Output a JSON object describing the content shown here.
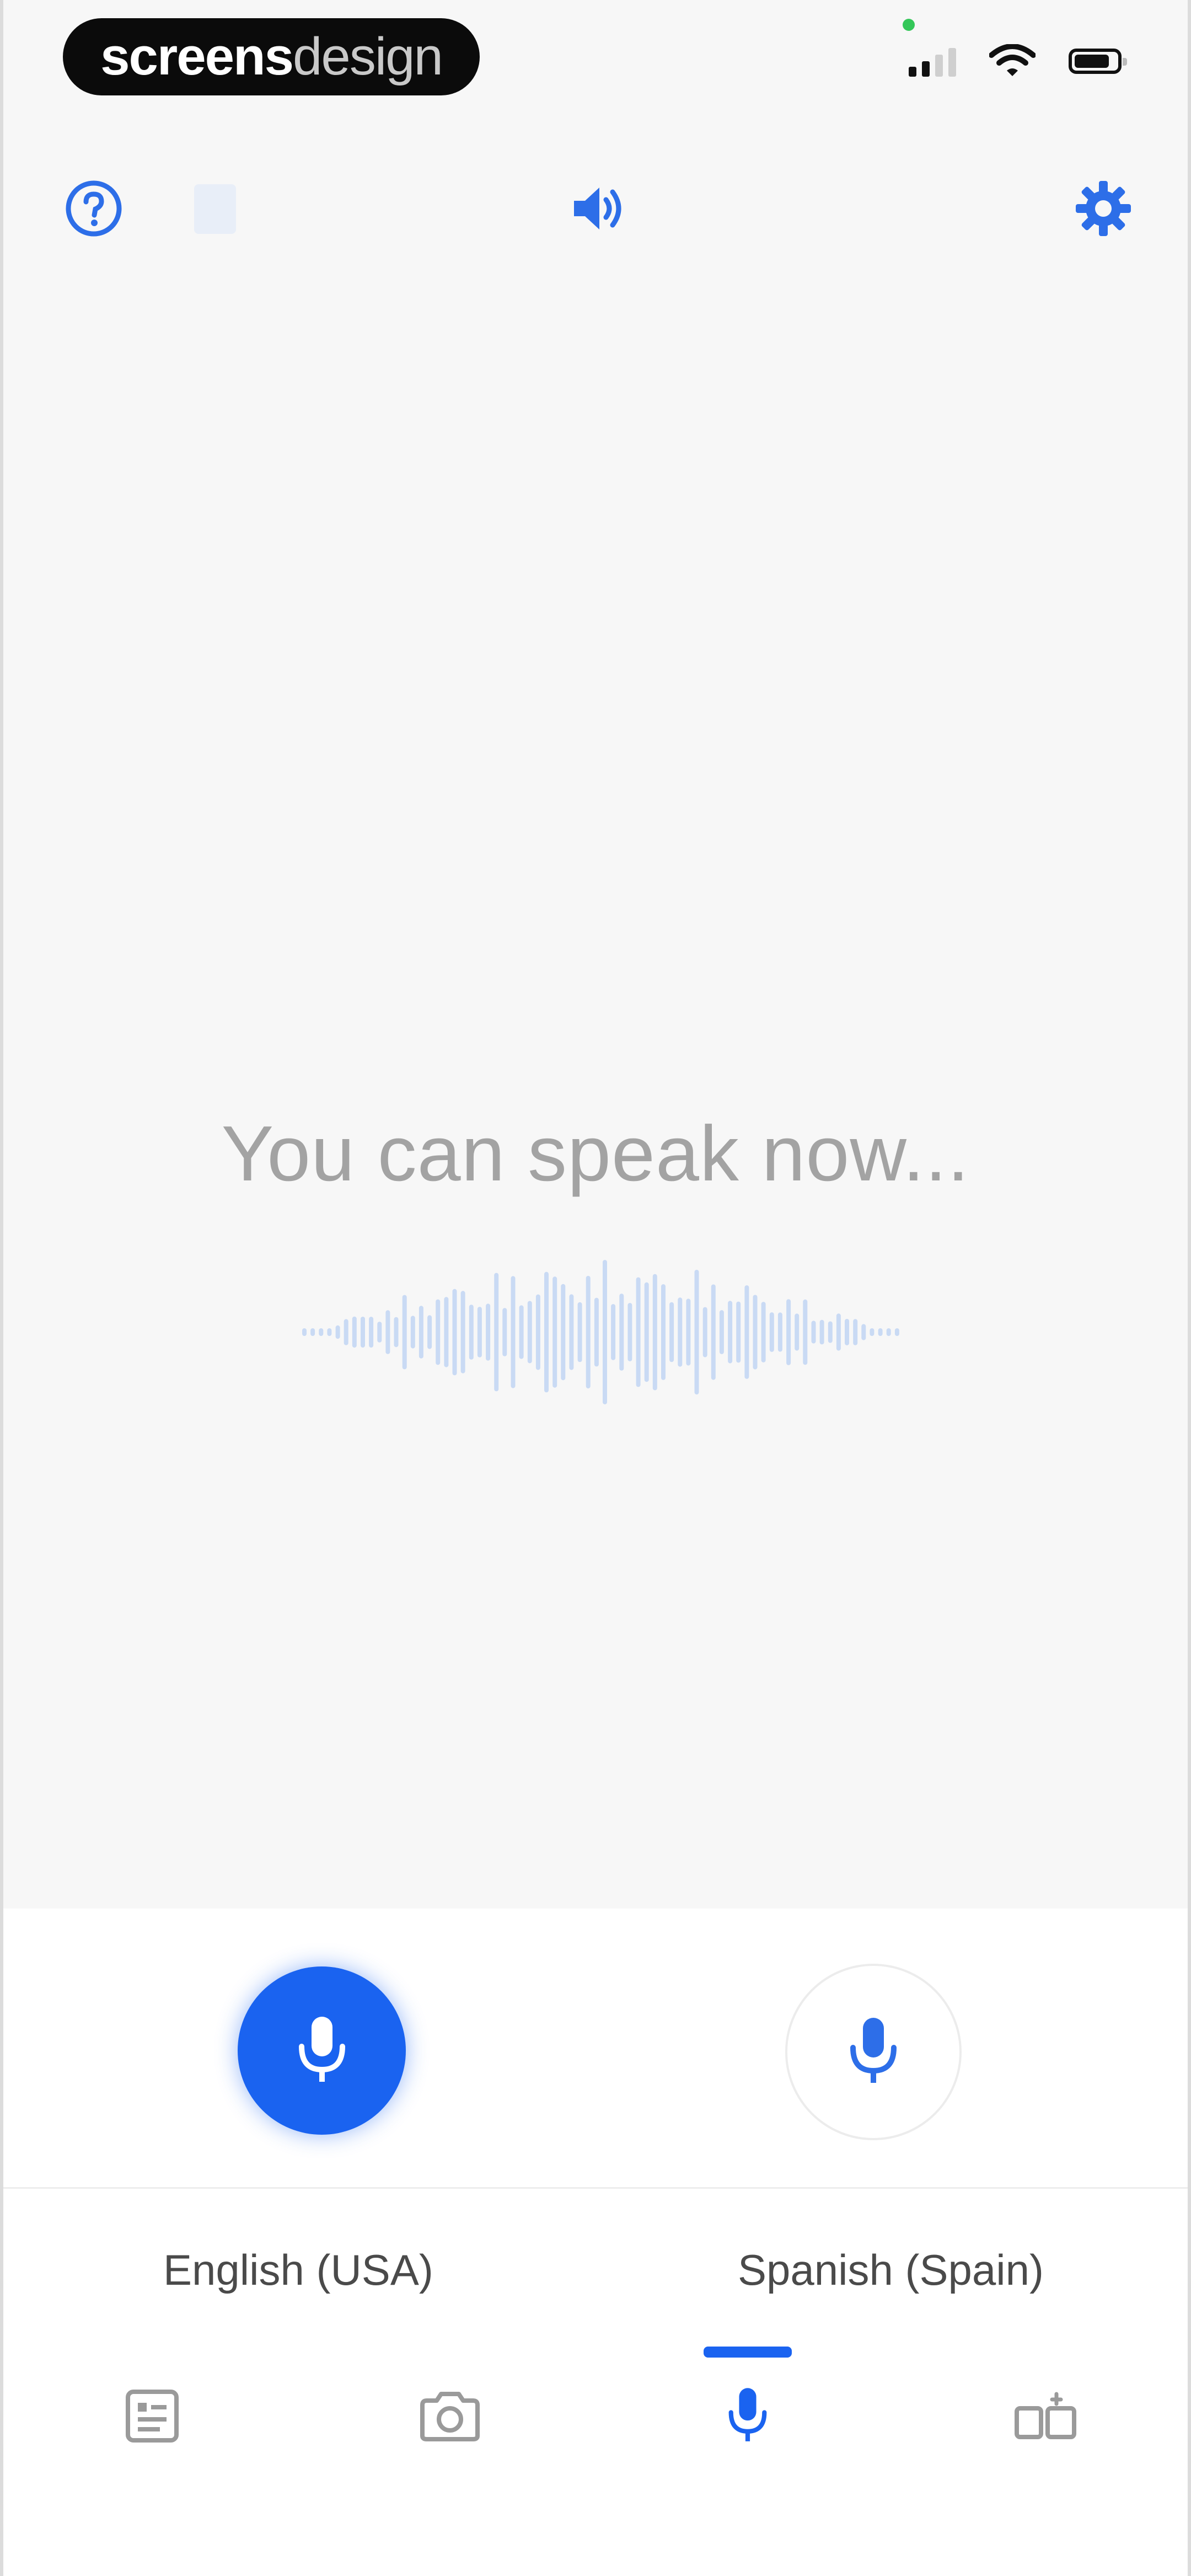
{
  "status_bar": {
    "brand_primary": "screens",
    "brand_secondary": "design"
  },
  "toolbar": {
    "help_icon": "help-circle-icon",
    "speaker_icon": "speaker-icon",
    "settings_icon": "gear-icon"
  },
  "main": {
    "prompt": "You can speak now...",
    "wave_icon": "sound-wave-icon"
  },
  "mic": {
    "primary_icon": "microphone-icon",
    "secondary_icon": "microphone-icon"
  },
  "languages": {
    "source": "English (USA)",
    "target": "Spanish (Spain)"
  },
  "tabs": [
    {
      "name": "text",
      "icon": "text-document-icon",
      "active": false
    },
    {
      "name": "camera",
      "icon": "camera-icon",
      "active": false
    },
    {
      "name": "voice",
      "icon": "microphone-icon",
      "active": true
    },
    {
      "name": "conversation",
      "icon": "conversation-icon",
      "active": false
    }
  ],
  "colors": {
    "accent": "#1a63f0",
    "prompt_text": "#a3a3a3",
    "background": "#f7f7f7"
  }
}
